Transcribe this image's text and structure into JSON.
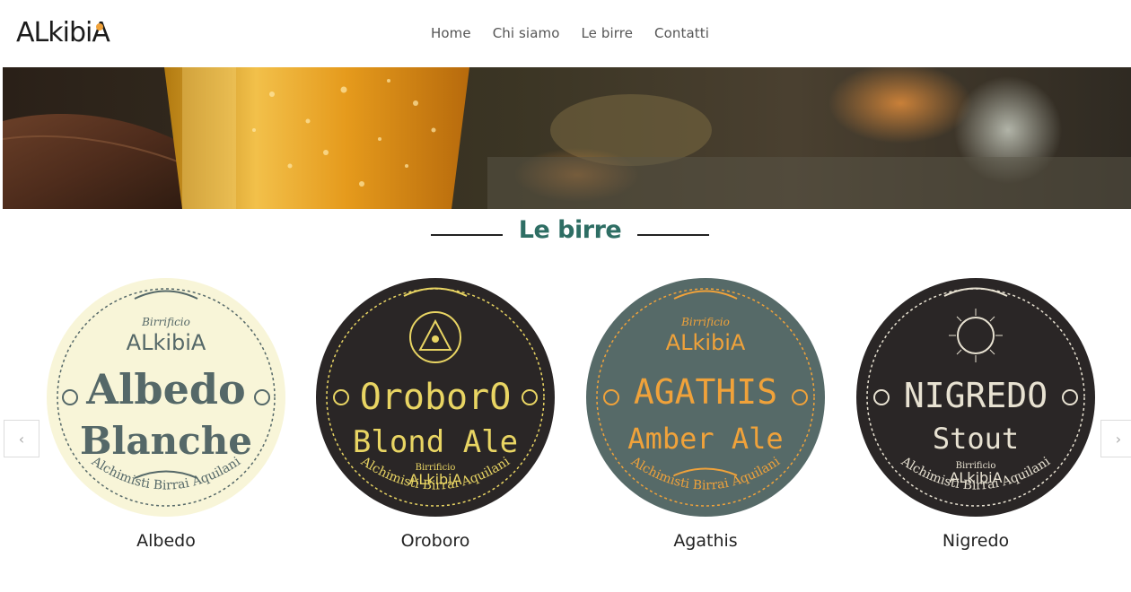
{
  "header": {
    "logo_text": "ALkibiA",
    "nav": [
      {
        "label": "Home"
      },
      {
        "label": "Chi siamo"
      },
      {
        "label": "Le birre"
      },
      {
        "label": "Contatti"
      }
    ]
  },
  "section": {
    "title": "Le birre"
  },
  "carousel": {
    "prev_icon": "chevron-left-icon",
    "next_icon": "chevron-right-icon",
    "items": [
      {
        "name": "Albedo",
        "coaster": {
          "top": "Birrificio",
          "brand": "ALkibiA",
          "line1": "Albedo",
          "line2": "Blanche",
          "motto": "Alchimisti Birrai Aquilani"
        },
        "colors": {
          "bg": "#f8f5d8",
          "fg": "#556868"
        }
      },
      {
        "name": "Oroboro",
        "coaster": {
          "top": "Birrificio",
          "brand": "ALkibiA",
          "line1": "OroborO",
          "line2": "Blond Ale",
          "motto": "Alchimisti Birrai Aquilani"
        },
        "colors": {
          "bg": "#2a2626",
          "fg": "#e9d563"
        }
      },
      {
        "name": "Agathis",
        "coaster": {
          "top": "Birrificio",
          "brand": "ALkibiA",
          "line1": "AGATHIS",
          "line2": "Amber Ale",
          "motto": "Alchimisti Birrai Aquilani"
        },
        "colors": {
          "bg": "#566a68",
          "fg": "#f0a23a"
        }
      },
      {
        "name": "Nigredo",
        "coaster": {
          "top": "Birrificio",
          "brand": "ALkibiA",
          "line1": "NIGREDO",
          "line2": "Stout",
          "motto": "Alchimisti Birrai Aquilani"
        },
        "colors": {
          "bg": "#2a2626",
          "fg": "#e8e2d2"
        }
      }
    ]
  }
}
